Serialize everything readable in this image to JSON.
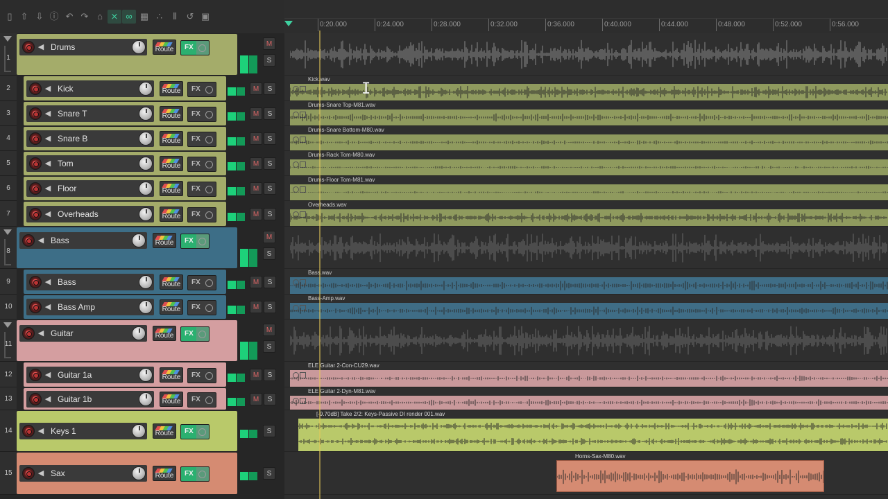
{
  "toolbar": {
    "icons": [
      "new-project-icon",
      "open-project-icon",
      "save-project-icon",
      "project-info-icon",
      "undo-icon",
      "redo-icon",
      "metronome-icon",
      "ripple-edit-icon",
      "link-icon",
      "grid-icon",
      "snap-icon",
      "marker-icon",
      "loop-icon",
      "lock-icon"
    ]
  },
  "ruler": {
    "labels": [
      "0:20.000",
      "0:24.000",
      "0:28.000",
      "0:32.000",
      "0:36.000",
      "0:40.000",
      "0:44.000",
      "0:48.000",
      "0:52.000",
      "0:56.000"
    ]
  },
  "buttons": {
    "route": "Route",
    "fx": "FX",
    "mute": "M",
    "solo": "S"
  },
  "colors": {
    "drums": "#a4ac6a",
    "drums_lane": "#8f9a5e",
    "bass": "#3d6e87",
    "bass_lane": "#3f6d86",
    "guitar": "#d49ea0",
    "guitar_lane": "#c9999b",
    "keys": "#b9c96a",
    "sax": "#d58b72",
    "meter": "#1dd17a"
  },
  "tracks": [
    {
      "num": "1",
      "name": "Drums"
    },
    {
      "num": "2",
      "name": "Kick"
    },
    {
      "num": "3",
      "name": "Snare T"
    },
    {
      "num": "4",
      "name": "Snare B"
    },
    {
      "num": "5",
      "name": "Tom"
    },
    {
      "num": "6",
      "name": "Floor"
    },
    {
      "num": "7",
      "name": "Overheads"
    },
    {
      "num": "8",
      "name": "Bass"
    },
    {
      "num": "9",
      "name": "Bass"
    },
    {
      "num": "10",
      "name": "Bass Amp"
    },
    {
      "num": "11",
      "name": "Guitar"
    },
    {
      "num": "12",
      "name": "Guitar 1a"
    },
    {
      "num": "13",
      "name": "Guitar 1b"
    },
    {
      "num": "14",
      "name": "Keys 1"
    },
    {
      "num": "15",
      "name": "Sax"
    }
  ],
  "items": {
    "kick": "Kick.wav",
    "snare_top": "Drums-Snare Top-M81.wav",
    "snare_bottom": "Drums-Snare Bottom-M80.wav",
    "rack_tom": "Drums-Rack Tom-M80.wav",
    "floor_tom": "Drums-Floor Tom-M81.wav",
    "overheads": "Overheads.wav",
    "bass": "Bass.wav",
    "bass_amp": "Bass-Amp.wav",
    "guitar_a": "ELE Guitar 2-Con-CU29.wav",
    "guitar_b": "ELE Guitar 2-Dyn-M81.wav",
    "keys": "[-9.70dB] Take 2/2: Keys-Passive DI render 001.wav",
    "sax": "Horns-Sax-M80.wav"
  }
}
